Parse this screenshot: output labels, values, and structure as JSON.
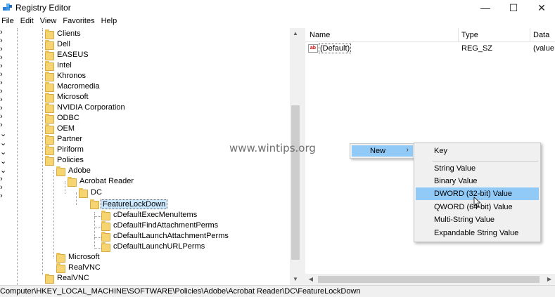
{
  "window": {
    "title": "Registry Editor",
    "minimize": "—",
    "maximize": "☐",
    "close": "✕"
  },
  "menu": [
    "File",
    "Edit",
    "View",
    "Favorites",
    "Help"
  ],
  "tree": {
    "items": [
      {
        "label": "Clients"
      },
      {
        "label": "Dell"
      },
      {
        "label": "EASEUS"
      },
      {
        "label": "Intel"
      },
      {
        "label": "Khronos"
      },
      {
        "label": "Macromedia"
      },
      {
        "label": "Microsoft"
      },
      {
        "label": "NVIDIA Corporation"
      },
      {
        "label": "ODBC"
      },
      {
        "label": "OEM"
      },
      {
        "label": "Partner"
      },
      {
        "label": "Piriform"
      },
      {
        "label": "Policies"
      },
      {
        "label": "Adobe"
      },
      {
        "label": "Acrobat Reader"
      },
      {
        "label": "DC"
      },
      {
        "label": "FeatureLockDown"
      },
      {
        "label": "cDefaultExecMenuItems"
      },
      {
        "label": "cDefaultFindAttachmentPerms"
      },
      {
        "label": "cDefaultLaunchAttachmentPerms"
      },
      {
        "label": "cDefaultLaunchURLPerms"
      },
      {
        "label": "Microsoft"
      },
      {
        "label": "RealVNC"
      },
      {
        "label": "RealVNC"
      }
    ]
  },
  "list": {
    "columns": [
      "Name",
      "Type",
      "Data"
    ],
    "rows": [
      {
        "icon": "ab",
        "name": "(Default)",
        "type": "REG_SZ",
        "data": "(value"
      }
    ]
  },
  "status": {
    "path": "Computer\\HKEY_LOCAL_MACHINE\\SOFTWARE\\Policies\\Adobe\\Acrobat Reader\\DC\\FeatureLockDown"
  },
  "watermark": "www.wintips.org",
  "context_menu": {
    "new_label": "New",
    "new_arrow": "›"
  },
  "submenu": {
    "items": [
      {
        "label": "Key"
      },
      {
        "label": "String Value"
      },
      {
        "label": "Binary Value"
      },
      {
        "label": "DWORD (32-bit) Value"
      },
      {
        "label": "QWORD (64-bit) Value"
      },
      {
        "label": "Multi-String Value"
      },
      {
        "label": "Expandable String Value"
      }
    ]
  },
  "colors": {
    "highlight": "#91c9f7",
    "folder": "#f6d472",
    "selection": "#cce8ff"
  }
}
